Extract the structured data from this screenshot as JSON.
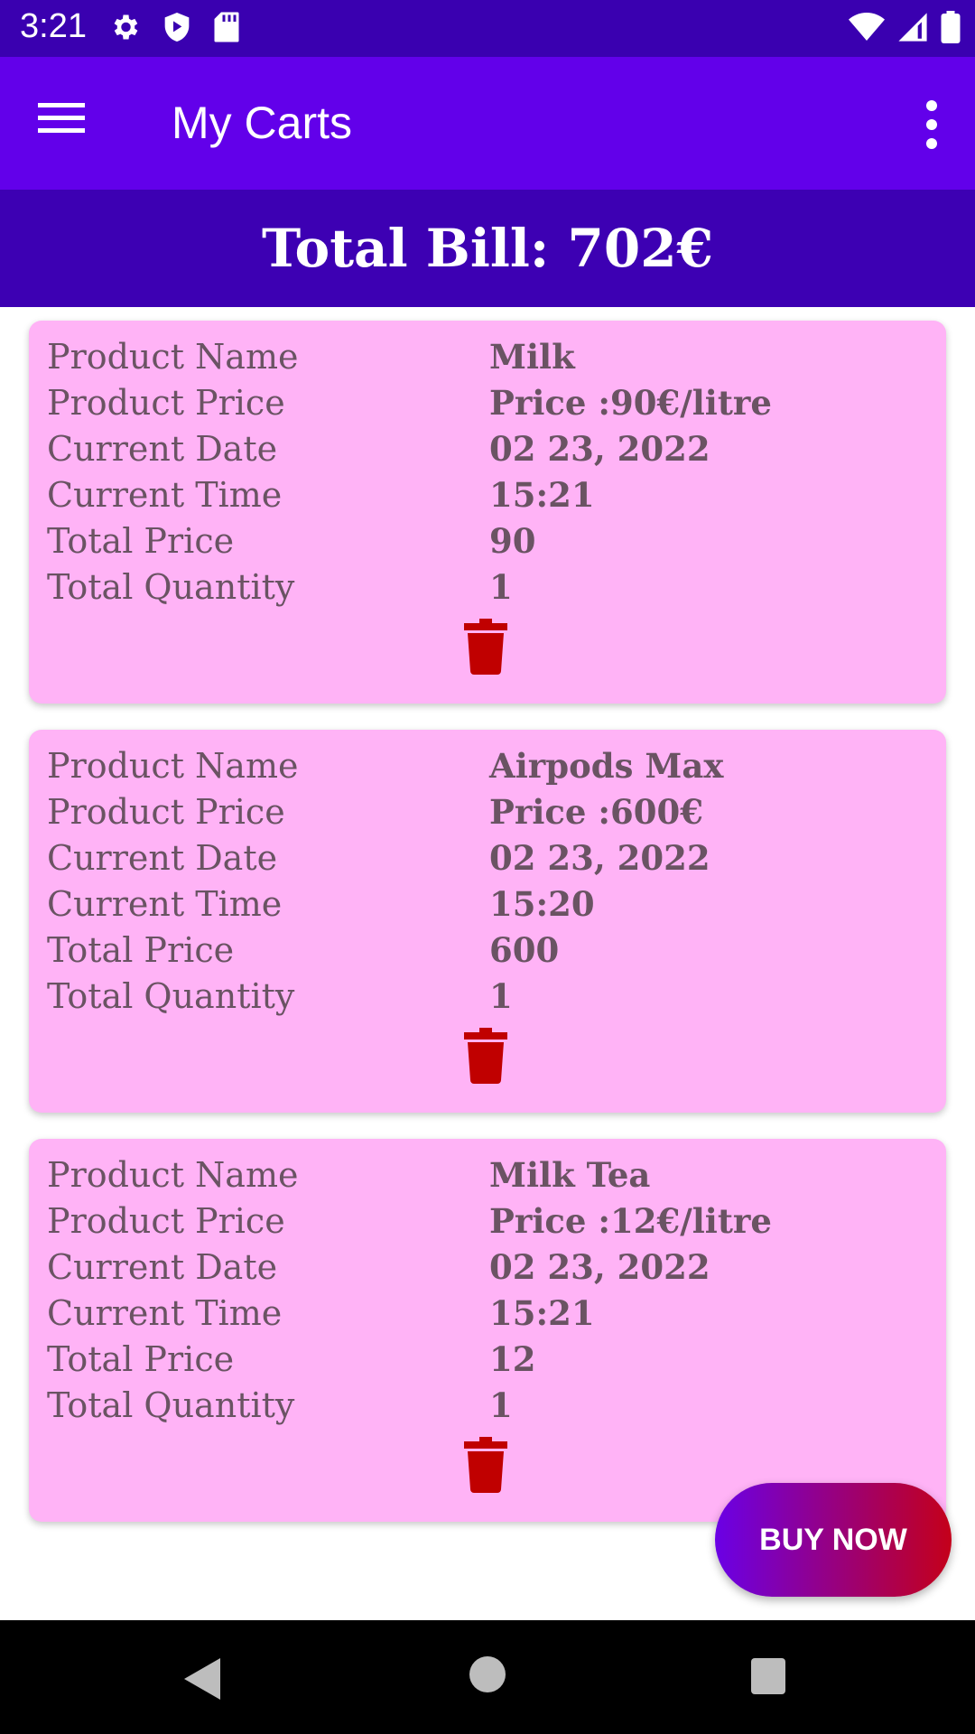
{
  "status_bar": {
    "time": "3:21",
    "icons_left": [
      "settings-icon",
      "shield-play-icon",
      "sd-card-icon"
    ],
    "icons_right": [
      "wifi-icon",
      "signal-icon",
      "battery-icon"
    ]
  },
  "app_bar": {
    "title": "My Carts",
    "menu_icon": "hamburger-menu-icon",
    "overflow_icon": "more-vert-icon"
  },
  "total_bill": "Total Bill: 702€",
  "labels": {
    "name": "Product Name",
    "price": "Product Price",
    "date": "Current Date",
    "time": "Current Time",
    "total_price": "Total Price",
    "quantity": "Total Quantity"
  },
  "carts": [
    {
      "name": "Milk",
      "price": "Price :90€/litre",
      "date": "02 23, 2022",
      "time": "15:21",
      "total_price": "90",
      "quantity": "1"
    },
    {
      "name": "Airpods Max",
      "price": "Price :600€",
      "date": "02 23, 2022",
      "time": "15:20",
      "total_price": "600",
      "quantity": "1"
    },
    {
      "name": "Milk Tea",
      "price": "Price :12€/litre",
      "date": "02 23, 2022",
      "time": "15:21",
      "total_price": "12",
      "quantity": "1"
    }
  ],
  "buy_now_label": "BUY NOW",
  "colors": {
    "status_bar": "#3a00b0",
    "app_bar": "#6200ea",
    "banner": "#3d00b3",
    "card": "#ffb3f6",
    "delete_icon": "#c00000",
    "text": "#6a5363"
  }
}
